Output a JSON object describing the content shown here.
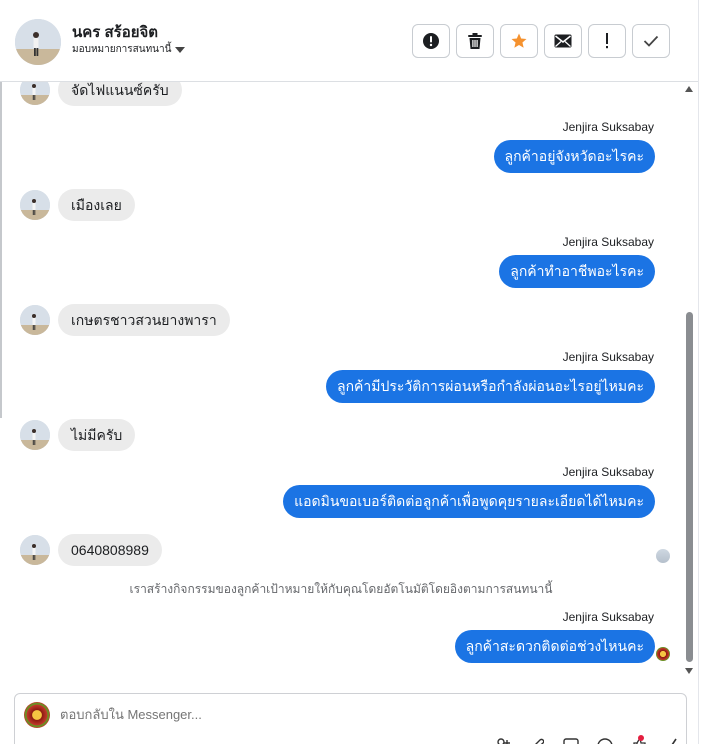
{
  "header": {
    "contact_name": "นคร สร้อยจิต",
    "assign_label": "มอบหมายการสนทนานี้"
  },
  "actions": [
    {
      "icon": "alert-circle-icon",
      "name": "spam-button"
    },
    {
      "icon": "trash-icon",
      "name": "delete-button"
    },
    {
      "icon": "star-icon",
      "name": "star-button"
    },
    {
      "icon": "envelope-icon",
      "name": "mark-unread-button"
    },
    {
      "icon": "exclamation-icon",
      "name": "follow-up-button"
    },
    {
      "icon": "check-icon",
      "name": "mark-done-button"
    }
  ],
  "messages": {
    "in_1": "จัดไฟแนนซ์ครับ",
    "out_1_sender": "Jenjira Suksabay",
    "out_1": "ลูกค้าอยู่จังหวัดอะไรคะ",
    "in_2": "เมืองเลย",
    "out_2_sender": "Jenjira Suksabay",
    "out_2": "ลูกค้าทำอาชีพอะไรคะ",
    "in_3": "เกษตรชาวสวนยางพารา",
    "out_3_sender": "Jenjira Suksabay",
    "out_3": "ลูกค้ามีประวัติการผ่อนหรือกำลังผ่อนอะไรอยู่ไหมคะ",
    "in_4": "ไม่มีครับ",
    "out_4_sender": "Jenjira Suksabay",
    "out_4": "แอดมินขอเบอร์ติดต่อลูกค้าเพื่อพูดคุยรายละเอียดได้ไหมคะ",
    "in_5": "0640808989",
    "system_note": "เราสร้างกิจกรรมของลูกค้าเป้าหมายให้กับคุณโดยอัตโนมัติโดยอิงตามการสนทนานี้",
    "out_5_sender": "Jenjira Suksabay",
    "out_5": "ลูกค้าสะดวกติดต่อช่วงไหนคะ"
  },
  "composer": {
    "placeholder": "ตอบกลับใน Messenger..."
  },
  "colors": {
    "outgoing_bubble": "#1b74e4",
    "incoming_bubble": "#ebebeb",
    "star": "#f5922f",
    "notification_dot": "#e41e3f"
  }
}
